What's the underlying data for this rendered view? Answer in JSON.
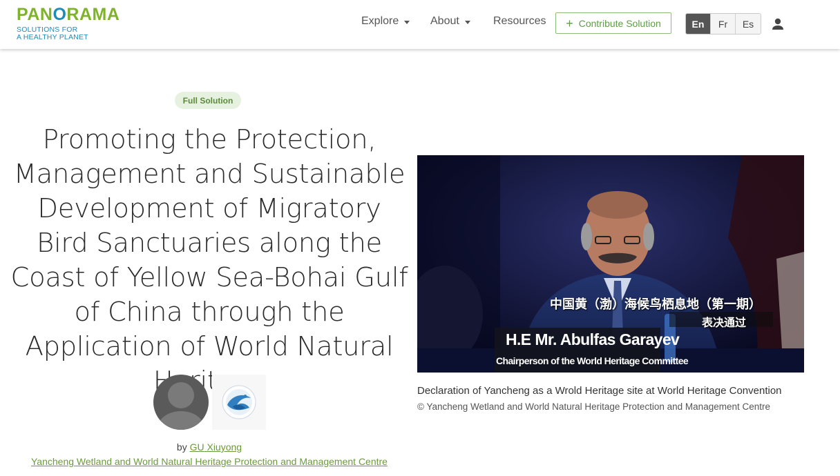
{
  "header": {
    "logo": {
      "word_part1": "PAN",
      "word_part2": "O",
      "word_part3": "RAMA",
      "tagline_line1": "SOLUTIONS FOR",
      "tagline_line2": "A HEALTHY PLANET"
    },
    "nav": [
      {
        "label": "Explore",
        "has_dropdown": true
      },
      {
        "label": "About",
        "has_dropdown": true
      },
      {
        "label": "Resources",
        "has_dropdown": false
      }
    ],
    "contribute_label": "Contribute Solution",
    "languages": [
      {
        "code": "En",
        "active": true
      },
      {
        "code": "Fr",
        "active": false
      },
      {
        "code": "Es",
        "active": false
      }
    ],
    "user_icon": "person-icon"
  },
  "main": {
    "badge": "Full Solution",
    "title": "Promoting the Protection, Management and Sustainable Development of Migratory Bird Sanctuaries along the Coast of Yellow Sea-Bohai Gulf of China through the Application of World Natural Heritage",
    "byline_prefix": "by",
    "author_name": "GU Xiuyong",
    "organization": "Yancheng Wetland and World Natural Heritage Protection and Management Centre"
  },
  "media": {
    "overlay_chinese_line1": "中国黄（渤）海候鸟栖息地（第一期）",
    "overlay_chinese_line2": "表决通过",
    "nameplate_name": "H.E Mr. Abulfas Garayev",
    "nameplate_title": "Chairperson of the World Heritage Committee",
    "caption": "Declaration of Yancheng as a Wrold Heritage site at World Heritage Convention",
    "credit": "© Yancheng Wetland and World Natural Heritage Protection and Management Centre"
  },
  "colors": {
    "brand_green": "#7fb32c",
    "brand_blue": "#1f8bb7",
    "link_green": "#6b9a3a",
    "active_lang_bg": "#555555"
  }
}
